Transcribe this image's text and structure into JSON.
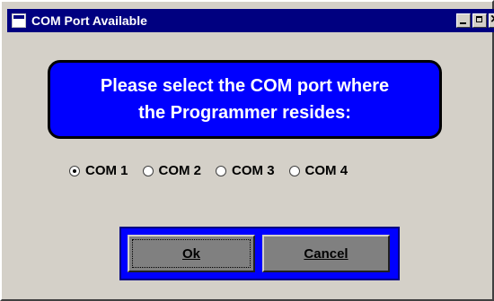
{
  "window": {
    "title": "COM Port Available",
    "title_icon": "window-icon",
    "controls": [
      "minimize-icon",
      "maximize-icon",
      "close-icon"
    ]
  },
  "banner": {
    "line1": "Please select the COM port where",
    "line2": "the Programmer resides:"
  },
  "ports": {
    "selected": "COM 1",
    "options": [
      {
        "label": "COM 1",
        "checked": true
      },
      {
        "label": "COM 2",
        "checked": false
      },
      {
        "label": "COM 3",
        "checked": false
      },
      {
        "label": "COM 4",
        "checked": false
      }
    ]
  },
  "buttons": {
    "ok_label": "Ok",
    "cancel_label": "Cancel"
  },
  "colors": {
    "titlebar": "#000080",
    "banner": "#0000ff",
    "dialog_bg": "#d4d0c8"
  }
}
